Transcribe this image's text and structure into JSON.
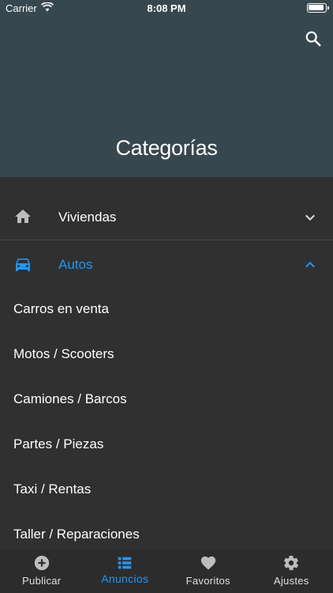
{
  "status_bar": {
    "carrier": "Carrier",
    "time": "8:08 PM"
  },
  "header": {
    "title": "Categorías",
    "search_icon": "search-icon"
  },
  "categories": [
    {
      "label": "Viviendas",
      "icon": "home-icon",
      "expanded": false
    },
    {
      "label": "Autos",
      "icon": "car-icon",
      "expanded": true,
      "subitems": [
        "Carros en venta",
        "Motos / Scooters",
        "Camiones / Barcos",
        "Partes / Piezas",
        "Taxi / Rentas",
        "Taller / Reparaciones"
      ]
    }
  ],
  "bottom_nav": [
    {
      "label": "Publicar",
      "icon": "add-circle-icon",
      "active": false
    },
    {
      "label": "Anuncios",
      "icon": "list-icon",
      "active": true
    },
    {
      "label": "Favoritos",
      "icon": "heart-icon",
      "active": false
    },
    {
      "label": "Ajustes",
      "icon": "gear-icon",
      "active": false
    }
  ],
  "colors": {
    "header_bg": "#37474f",
    "body_bg": "#303030",
    "accent": "#2196f3",
    "icon_gray": "#bdbdbd"
  }
}
